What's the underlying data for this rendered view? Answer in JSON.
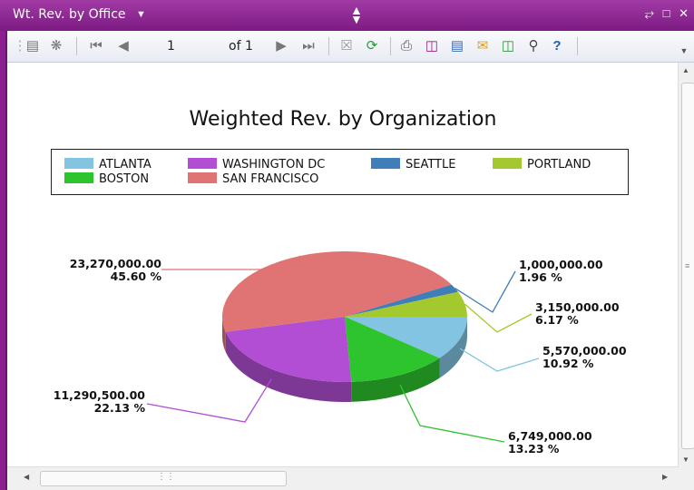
{
  "window": {
    "title": "Wt. Rev. by Office",
    "icons": [
      "dropdown-caret",
      "move-updown",
      "restore",
      "maximize",
      "close"
    ]
  },
  "toolbar": {
    "current_page": "1",
    "page_of": "of 1"
  },
  "chart_data": {
    "type": "pie",
    "title": "Weighted Rev. by Organization",
    "legend_position": "top",
    "three_d": true,
    "series": [
      {
        "name": "ATLANTA",
        "value": 5570000.0,
        "value_label": "5,570,000.00",
        "percent_label": "10.92 %",
        "color": "#82c4e2"
      },
      {
        "name": "WASHINGTON DC",
        "value": 11290500.0,
        "value_label": "11,290,500.00",
        "percent_label": "22.13 %",
        "color": "#b24ed4"
      },
      {
        "name": "SEATTLE",
        "value": 1000000.0,
        "value_label": "1,000,000.00",
        "percent_label": "1.96 %",
        "color": "#3f7eb8"
      },
      {
        "name": "PORTLAND",
        "value": 3150000.0,
        "value_label": "3,150,000.00",
        "percent_label": "6.17 %",
        "color": "#a4c92e"
      },
      {
        "name": "BOSTON",
        "value": 6749000.0,
        "value_label": "6,749,000.00",
        "percent_label": "13.23 %",
        "color": "#2ec42e"
      },
      {
        "name": "SAN FRANCISCO",
        "value": 23270000.0,
        "value_label": "23,270,000.00",
        "percent_label": "45.60 %",
        "color": "#e07474"
      }
    ]
  }
}
